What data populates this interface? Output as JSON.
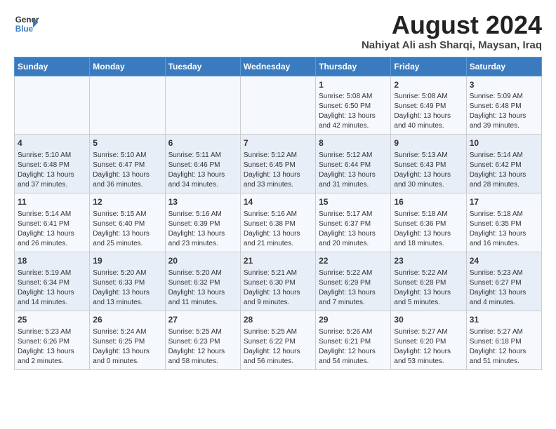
{
  "header": {
    "logo_line1": "General",
    "logo_line2": "Blue",
    "main_title": "August 2024",
    "subtitle": "Nahiyat Ali ash Sharqi, Maysan, Iraq"
  },
  "columns": [
    "Sunday",
    "Monday",
    "Tuesday",
    "Wednesday",
    "Thursday",
    "Friday",
    "Saturday"
  ],
  "weeks": [
    [
      {
        "day": "",
        "info": ""
      },
      {
        "day": "",
        "info": ""
      },
      {
        "day": "",
        "info": ""
      },
      {
        "day": "",
        "info": ""
      },
      {
        "day": "1",
        "info": "Sunrise: 5:08 AM\nSunset: 6:50 PM\nDaylight: 13 hours\nand 42 minutes."
      },
      {
        "day": "2",
        "info": "Sunrise: 5:08 AM\nSunset: 6:49 PM\nDaylight: 13 hours\nand 40 minutes."
      },
      {
        "day": "3",
        "info": "Sunrise: 5:09 AM\nSunset: 6:48 PM\nDaylight: 13 hours\nand 39 minutes."
      }
    ],
    [
      {
        "day": "4",
        "info": "Sunrise: 5:10 AM\nSunset: 6:48 PM\nDaylight: 13 hours\nand 37 minutes."
      },
      {
        "day": "5",
        "info": "Sunrise: 5:10 AM\nSunset: 6:47 PM\nDaylight: 13 hours\nand 36 minutes."
      },
      {
        "day": "6",
        "info": "Sunrise: 5:11 AM\nSunset: 6:46 PM\nDaylight: 13 hours\nand 34 minutes."
      },
      {
        "day": "7",
        "info": "Sunrise: 5:12 AM\nSunset: 6:45 PM\nDaylight: 13 hours\nand 33 minutes."
      },
      {
        "day": "8",
        "info": "Sunrise: 5:12 AM\nSunset: 6:44 PM\nDaylight: 13 hours\nand 31 minutes."
      },
      {
        "day": "9",
        "info": "Sunrise: 5:13 AM\nSunset: 6:43 PM\nDaylight: 13 hours\nand 30 minutes."
      },
      {
        "day": "10",
        "info": "Sunrise: 5:14 AM\nSunset: 6:42 PM\nDaylight: 13 hours\nand 28 minutes."
      }
    ],
    [
      {
        "day": "11",
        "info": "Sunrise: 5:14 AM\nSunset: 6:41 PM\nDaylight: 13 hours\nand 26 minutes."
      },
      {
        "day": "12",
        "info": "Sunrise: 5:15 AM\nSunset: 6:40 PM\nDaylight: 13 hours\nand 25 minutes."
      },
      {
        "day": "13",
        "info": "Sunrise: 5:16 AM\nSunset: 6:39 PM\nDaylight: 13 hours\nand 23 minutes."
      },
      {
        "day": "14",
        "info": "Sunrise: 5:16 AM\nSunset: 6:38 PM\nDaylight: 13 hours\nand 21 minutes."
      },
      {
        "day": "15",
        "info": "Sunrise: 5:17 AM\nSunset: 6:37 PM\nDaylight: 13 hours\nand 20 minutes."
      },
      {
        "day": "16",
        "info": "Sunrise: 5:18 AM\nSunset: 6:36 PM\nDaylight: 13 hours\nand 18 minutes."
      },
      {
        "day": "17",
        "info": "Sunrise: 5:18 AM\nSunset: 6:35 PM\nDaylight: 13 hours\nand 16 minutes."
      }
    ],
    [
      {
        "day": "18",
        "info": "Sunrise: 5:19 AM\nSunset: 6:34 PM\nDaylight: 13 hours\nand 14 minutes."
      },
      {
        "day": "19",
        "info": "Sunrise: 5:20 AM\nSunset: 6:33 PM\nDaylight: 13 hours\nand 13 minutes."
      },
      {
        "day": "20",
        "info": "Sunrise: 5:20 AM\nSunset: 6:32 PM\nDaylight: 13 hours\nand 11 minutes."
      },
      {
        "day": "21",
        "info": "Sunrise: 5:21 AM\nSunset: 6:30 PM\nDaylight: 13 hours\nand 9 minutes."
      },
      {
        "day": "22",
        "info": "Sunrise: 5:22 AM\nSunset: 6:29 PM\nDaylight: 13 hours\nand 7 minutes."
      },
      {
        "day": "23",
        "info": "Sunrise: 5:22 AM\nSunset: 6:28 PM\nDaylight: 13 hours\nand 5 minutes."
      },
      {
        "day": "24",
        "info": "Sunrise: 5:23 AM\nSunset: 6:27 PM\nDaylight: 13 hours\nand 4 minutes."
      }
    ],
    [
      {
        "day": "25",
        "info": "Sunrise: 5:23 AM\nSunset: 6:26 PM\nDaylight: 13 hours\nand 2 minutes."
      },
      {
        "day": "26",
        "info": "Sunrise: 5:24 AM\nSunset: 6:25 PM\nDaylight: 13 hours\nand 0 minutes."
      },
      {
        "day": "27",
        "info": "Sunrise: 5:25 AM\nSunset: 6:23 PM\nDaylight: 12 hours\nand 58 minutes."
      },
      {
        "day": "28",
        "info": "Sunrise: 5:25 AM\nSunset: 6:22 PM\nDaylight: 12 hours\nand 56 minutes."
      },
      {
        "day": "29",
        "info": "Sunrise: 5:26 AM\nSunset: 6:21 PM\nDaylight: 12 hours\nand 54 minutes."
      },
      {
        "day": "30",
        "info": "Sunrise: 5:27 AM\nSunset: 6:20 PM\nDaylight: 12 hours\nand 53 minutes."
      },
      {
        "day": "31",
        "info": "Sunrise: 5:27 AM\nSunset: 6:18 PM\nDaylight: 12 hours\nand 51 minutes."
      }
    ]
  ]
}
